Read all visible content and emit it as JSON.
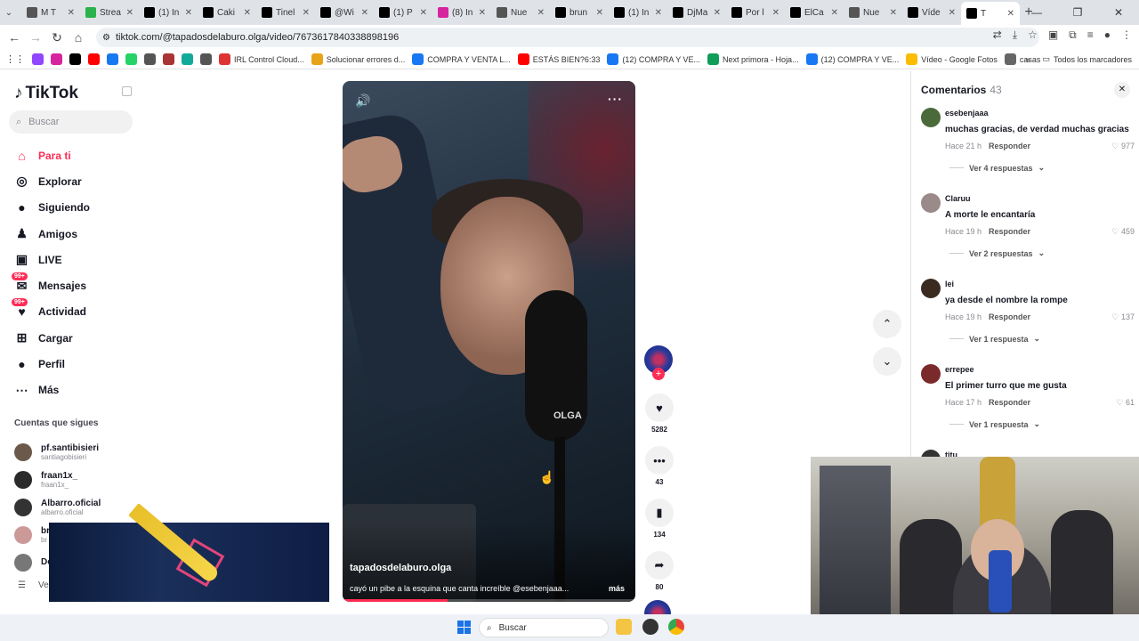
{
  "browser": {
    "tabs": [
      {
        "label": "M T",
        "color": "#555"
      },
      {
        "label": "Strea",
        "color": "#2bb24c"
      },
      {
        "label": "(1) In",
        "color": "#000"
      },
      {
        "label": "Caki",
        "color": "#000"
      },
      {
        "label": "Tinel",
        "color": "#000"
      },
      {
        "label": "@Wi",
        "color": "#000"
      },
      {
        "label": "(1) P",
        "color": "#000"
      },
      {
        "label": "(8) In",
        "color": "#d6249f"
      },
      {
        "label": "Nue",
        "color": "#555"
      },
      {
        "label": "brun",
        "color": "#000"
      },
      {
        "label": "(1) In",
        "color": "#000"
      },
      {
        "label": "DjMa",
        "color": "#000"
      },
      {
        "label": "Por l",
        "color": "#000"
      },
      {
        "label": "ElCa",
        "color": "#000"
      },
      {
        "label": "Nue",
        "color": "#555"
      },
      {
        "label": "Víde",
        "color": "#000"
      },
      {
        "label": "T",
        "color": "#000"
      }
    ],
    "url": "tiktok.com/@tapadosdelaburo.olga/video/7673617840338898196",
    "bookmarks": [
      {
        "label": "",
        "color": "#9146ff"
      },
      {
        "label": "",
        "color": "#d6249f"
      },
      {
        "label": "",
        "color": "#000"
      },
      {
        "label": "",
        "color": "#ff0000"
      },
      {
        "label": "",
        "color": "#1877f2"
      },
      {
        "label": "",
        "color": "#25d366"
      },
      {
        "label": "",
        "color": "#555"
      },
      {
        "label": "",
        "color": "#a33"
      },
      {
        "label": "",
        "color": "#1a9"
      },
      {
        "label": "",
        "color": "#555"
      },
      {
        "label": "IRL Control Cloud...",
        "color": "#d33"
      },
      {
        "label": "Solucionar errores d...",
        "color": "#e8a317"
      },
      {
        "label": "COMPRA Y VENTA L...",
        "color": "#1877f2"
      },
      {
        "label": "ESTÁS BIEN?6:33",
        "color": "#ff0000"
      },
      {
        "label": "(12) COMPRA Y VE...",
        "color": "#1877f2"
      },
      {
        "label": "Next primora - Hoja...",
        "color": "#0f9d58"
      },
      {
        "label": "(12) COMPRA Y VE...",
        "color": "#1877f2"
      },
      {
        "label": "Vídeo - Google Fotos",
        "color": "#fbbc04"
      },
      {
        "label": "casas",
        "color": "#666"
      }
    ],
    "all_bookmarks": "Todos los marcadores"
  },
  "sidebar": {
    "logo": "TikTok",
    "search_placeholder": "Buscar",
    "nav": [
      {
        "label": "Para ti",
        "icon": "home-icon",
        "glyph": "⌂",
        "active": true,
        "badge": ""
      },
      {
        "label": "Explorar",
        "icon": "compass-icon",
        "glyph": "◎",
        "active": false,
        "badge": ""
      },
      {
        "label": "Siguiendo",
        "icon": "following-avatar-icon",
        "glyph": "●",
        "active": false,
        "badge": ""
      },
      {
        "label": "Amigos",
        "icon": "friends-icon",
        "glyph": "♟",
        "active": false,
        "badge": ""
      },
      {
        "label": "LIVE",
        "icon": "live-icon",
        "glyph": "▣",
        "active": false,
        "badge": ""
      },
      {
        "label": "Mensajes",
        "icon": "messages-icon",
        "glyph": "✉",
        "active": false,
        "badge": "99+"
      },
      {
        "label": "Actividad",
        "icon": "activity-icon",
        "glyph": "♥",
        "active": false,
        "badge": "99+"
      },
      {
        "label": "Cargar",
        "icon": "upload-icon",
        "glyph": "⊞",
        "active": false,
        "badge": ""
      },
      {
        "label": "Perfil",
        "icon": "profile-avatar-icon",
        "glyph": "●",
        "active": false,
        "badge": ""
      },
      {
        "label": "Más",
        "icon": "more-icon",
        "glyph": "⋯",
        "active": false,
        "badge": ""
      }
    ],
    "following_title": "Cuentas que sigues",
    "following": [
      {
        "name": "pf.santibisieri",
        "handle": "santiagobisieri",
        "color": "#6b5a4a"
      },
      {
        "name": "fraan1x_",
        "handle": "fraan1x_",
        "color": "#2a2a2a"
      },
      {
        "name": "Albarro.oficial",
        "handle": "albarro.oficial",
        "color": "#333"
      },
      {
        "name": "br",
        "handle": "br",
        "color": "#c99"
      },
      {
        "name": "De",
        "handle": "",
        "color": "#777"
      }
    ],
    "see_more": "Ve"
  },
  "video": {
    "username": "tapadosdelaburo.olga",
    "caption": "cayó un pibe a la esquina que canta increíble @esebenjaaa...",
    "more": "más",
    "mic_label": "OLGA",
    "progress": 0.36
  },
  "actions": {
    "likes": "5282",
    "comments": "43",
    "saves": "134",
    "shares": "80"
  },
  "comments_panel": {
    "title": "Comentarios",
    "count": "43",
    "items": [
      {
        "user": "esebenjaaa",
        "text": "muchas gracias, de verdad muchas gracias",
        "time": "Hace 21 h",
        "reply": "Responder",
        "likes": "977",
        "replies": "Ver 4 respuestas",
        "color": "#4a6a3a"
      },
      {
        "user": "Claruu",
        "text": "A morte le encantaría",
        "time": "Hace 19 h",
        "reply": "Responder",
        "likes": "459",
        "replies": "Ver 2 respuestas",
        "color": "#9a8a8a"
      },
      {
        "user": "lei",
        "text": "ya desde el nombre la rompe",
        "time": "Hace 19 h",
        "reply": "Responder",
        "likes": "137",
        "replies": "Ver 1 respuesta",
        "color": "#3a2a20"
      },
      {
        "user": "errepee",
        "text": "El primer turro que me gusta",
        "time": "Hace 17 h",
        "reply": "Responder",
        "likes": "61",
        "replies": "Ver 1 respuesta",
        "color": "#7a2a2a"
      },
      {
        "user": "titu",
        "text": "",
        "time": "",
        "reply": "",
        "likes": "",
        "replies": "",
        "color": "#333"
      }
    ]
  },
  "taskbar": {
    "search_placeholder": "Buscar"
  }
}
